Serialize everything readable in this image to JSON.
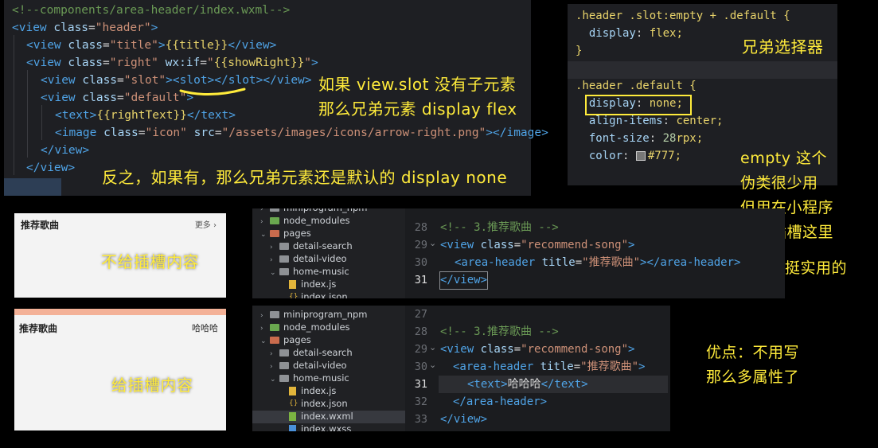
{
  "top_code": {
    "lines": [
      {
        "parts": [
          [
            "cmt",
            "<!--components/area-header/index.wxml-->"
          ]
        ]
      },
      {
        "parts": [
          [
            "tag",
            "<view "
          ],
          [
            "attr",
            "class"
          ],
          [
            "txt",
            "="
          ],
          [
            "str",
            "\"header\""
          ],
          [
            "tag",
            ">"
          ]
        ]
      },
      {
        "parts": [
          [
            "tag",
            "<view "
          ],
          [
            "attr",
            "class"
          ],
          [
            "txt",
            "="
          ],
          [
            "str",
            "\"title\""
          ],
          [
            "tag",
            ">"
          ],
          [
            "yel",
            "{{title}}"
          ],
          [
            "tag",
            "</view>"
          ]
        ]
      },
      {
        "parts": [
          [
            "tag",
            "<view "
          ],
          [
            "attr",
            "class"
          ],
          [
            "txt",
            "="
          ],
          [
            "str",
            "\"right\" "
          ],
          [
            "attr",
            "wx:if"
          ],
          [
            "txt",
            "="
          ],
          [
            "str",
            "\""
          ],
          [
            "yel",
            "{{showRight}}"
          ],
          [
            "str",
            "\""
          ],
          [
            "tag",
            ">"
          ]
        ]
      },
      {
        "parts": [
          [
            "tag",
            "<view "
          ],
          [
            "attr",
            "class"
          ],
          [
            "txt",
            "="
          ],
          [
            "str",
            "\"slot\""
          ],
          [
            "tag",
            ">"
          ],
          [
            "tag",
            "<slot></slot>"
          ],
          [
            "tag",
            "</view>"
          ]
        ]
      },
      {
        "parts": [
          [
            "tag",
            "<view "
          ],
          [
            "attr",
            "class"
          ],
          [
            "txt",
            "="
          ],
          [
            "str",
            "\"default\""
          ],
          [
            "tag",
            ">"
          ]
        ]
      },
      {
        "parts": [
          [
            "tag",
            "<text>"
          ],
          [
            "yel",
            "{{rightText}}"
          ],
          [
            "tag",
            "</text>"
          ]
        ]
      },
      {
        "parts": [
          [
            "tag",
            "<image "
          ],
          [
            "attr",
            "class"
          ],
          [
            "txt",
            "="
          ],
          [
            "str",
            "\"icon\" "
          ],
          [
            "attr",
            "src"
          ],
          [
            "txt",
            "="
          ],
          [
            "str",
            "\"/assets/images/icons/arrow-right.png\""
          ],
          [
            "tag",
            "></image>"
          ]
        ]
      },
      {
        "parts": [
          [
            "tag",
            "</view>"
          ]
        ]
      },
      {
        "parts": [
          [
            "tag",
            "</view>"
          ]
        ]
      },
      {
        "parts": [
          [
            "tag",
            "</view>"
          ]
        ]
      }
    ]
  },
  "css_code": {
    "lines": [
      ".header .slot:empty + .default {",
      "  display: flex;",
      "}",
      ".header .default {",
      "  display: none;",
      "  align-items: center;",
      "  font-size: 28rpx;",
      "  color: #777;"
    ],
    "swatch_color": "#777777"
  },
  "annotations": {
    "sibling_selector": "兄弟选择器",
    "if_empty_1": "如果 view.slot 没有子元素",
    "if_empty_2": "那么兄弟元素 display flex",
    "otherwise": "反之，如果有，那么兄弟元素还是默认的 display none",
    "empty_note": [
      "empty 这个",
      "伪类很少用",
      "但用在小程序",
      "这个插槽这里",
      "还是挺实用的"
    ],
    "no_slot": "不给插槽内容",
    "give_slot": "给插槽内容",
    "advantage": [
      "优点：不用写",
      "那么多属性了"
    ]
  },
  "phone1": {
    "title": "推荐歌曲",
    "more": "更多 ›"
  },
  "phone2": {
    "title": "推荐歌曲",
    "right": "哈哈哈"
  },
  "tree1": {
    "items": [
      "miniprogram_npm",
      "node_modules",
      "pages",
      "detail-search",
      "detail-video",
      "home-music",
      "index.js",
      "index.json"
    ]
  },
  "tree2": {
    "items": [
      "miniprogram_npm",
      "node_modules",
      "pages",
      "detail-search",
      "detail-video",
      "home-music",
      "index.js",
      "index.json",
      "index.wxml",
      "index.wxss"
    ]
  },
  "editor1": {
    "line_numbers": [
      "28",
      "29",
      "30",
      "31"
    ],
    "lines": [
      [
        [
          "cmt",
          "<!-- 3.推荐歌曲 -->"
        ]
      ],
      [
        [
          "tag",
          "<view "
        ],
        [
          "attr",
          "class"
        ],
        [
          "txt",
          "="
        ],
        [
          "str",
          "\"recommend-song\""
        ],
        [
          "tag",
          ">"
        ]
      ],
      [
        [
          "tag",
          "<area-header "
        ],
        [
          "attr",
          "title"
        ],
        [
          "txt",
          "="
        ],
        [
          "str",
          "\"推荐歌曲\""
        ],
        [
          "tag",
          "></area-header>"
        ]
      ],
      [
        [
          "tag",
          "</view>"
        ]
      ]
    ]
  },
  "editor2": {
    "line_numbers": [
      "27",
      "28",
      "29",
      "30",
      "31",
      "32",
      "33"
    ],
    "lines": [
      [],
      [
        [
          "cmt",
          "<!-- 3.推荐歌曲 -->"
        ]
      ],
      [
        [
          "tag",
          "<view "
        ],
        [
          "attr",
          "class"
        ],
        [
          "txt",
          "="
        ],
        [
          "str",
          "\"recommend-song\""
        ],
        [
          "tag",
          ">"
        ]
      ],
      [
        [
          "tag",
          "<area-header "
        ],
        [
          "attr",
          "title"
        ],
        [
          "txt",
          "="
        ],
        [
          "str",
          "\"推荐歌曲\""
        ],
        [
          "tag",
          ">"
        ]
      ],
      [
        [
          "tag",
          "<text>"
        ],
        [
          "txt",
          "哈哈哈"
        ],
        [
          "tag",
          "</text>"
        ]
      ],
      [
        [
          "tag",
          "</area-header>"
        ]
      ],
      [
        [
          "tag",
          "</view>"
        ]
      ]
    ]
  }
}
